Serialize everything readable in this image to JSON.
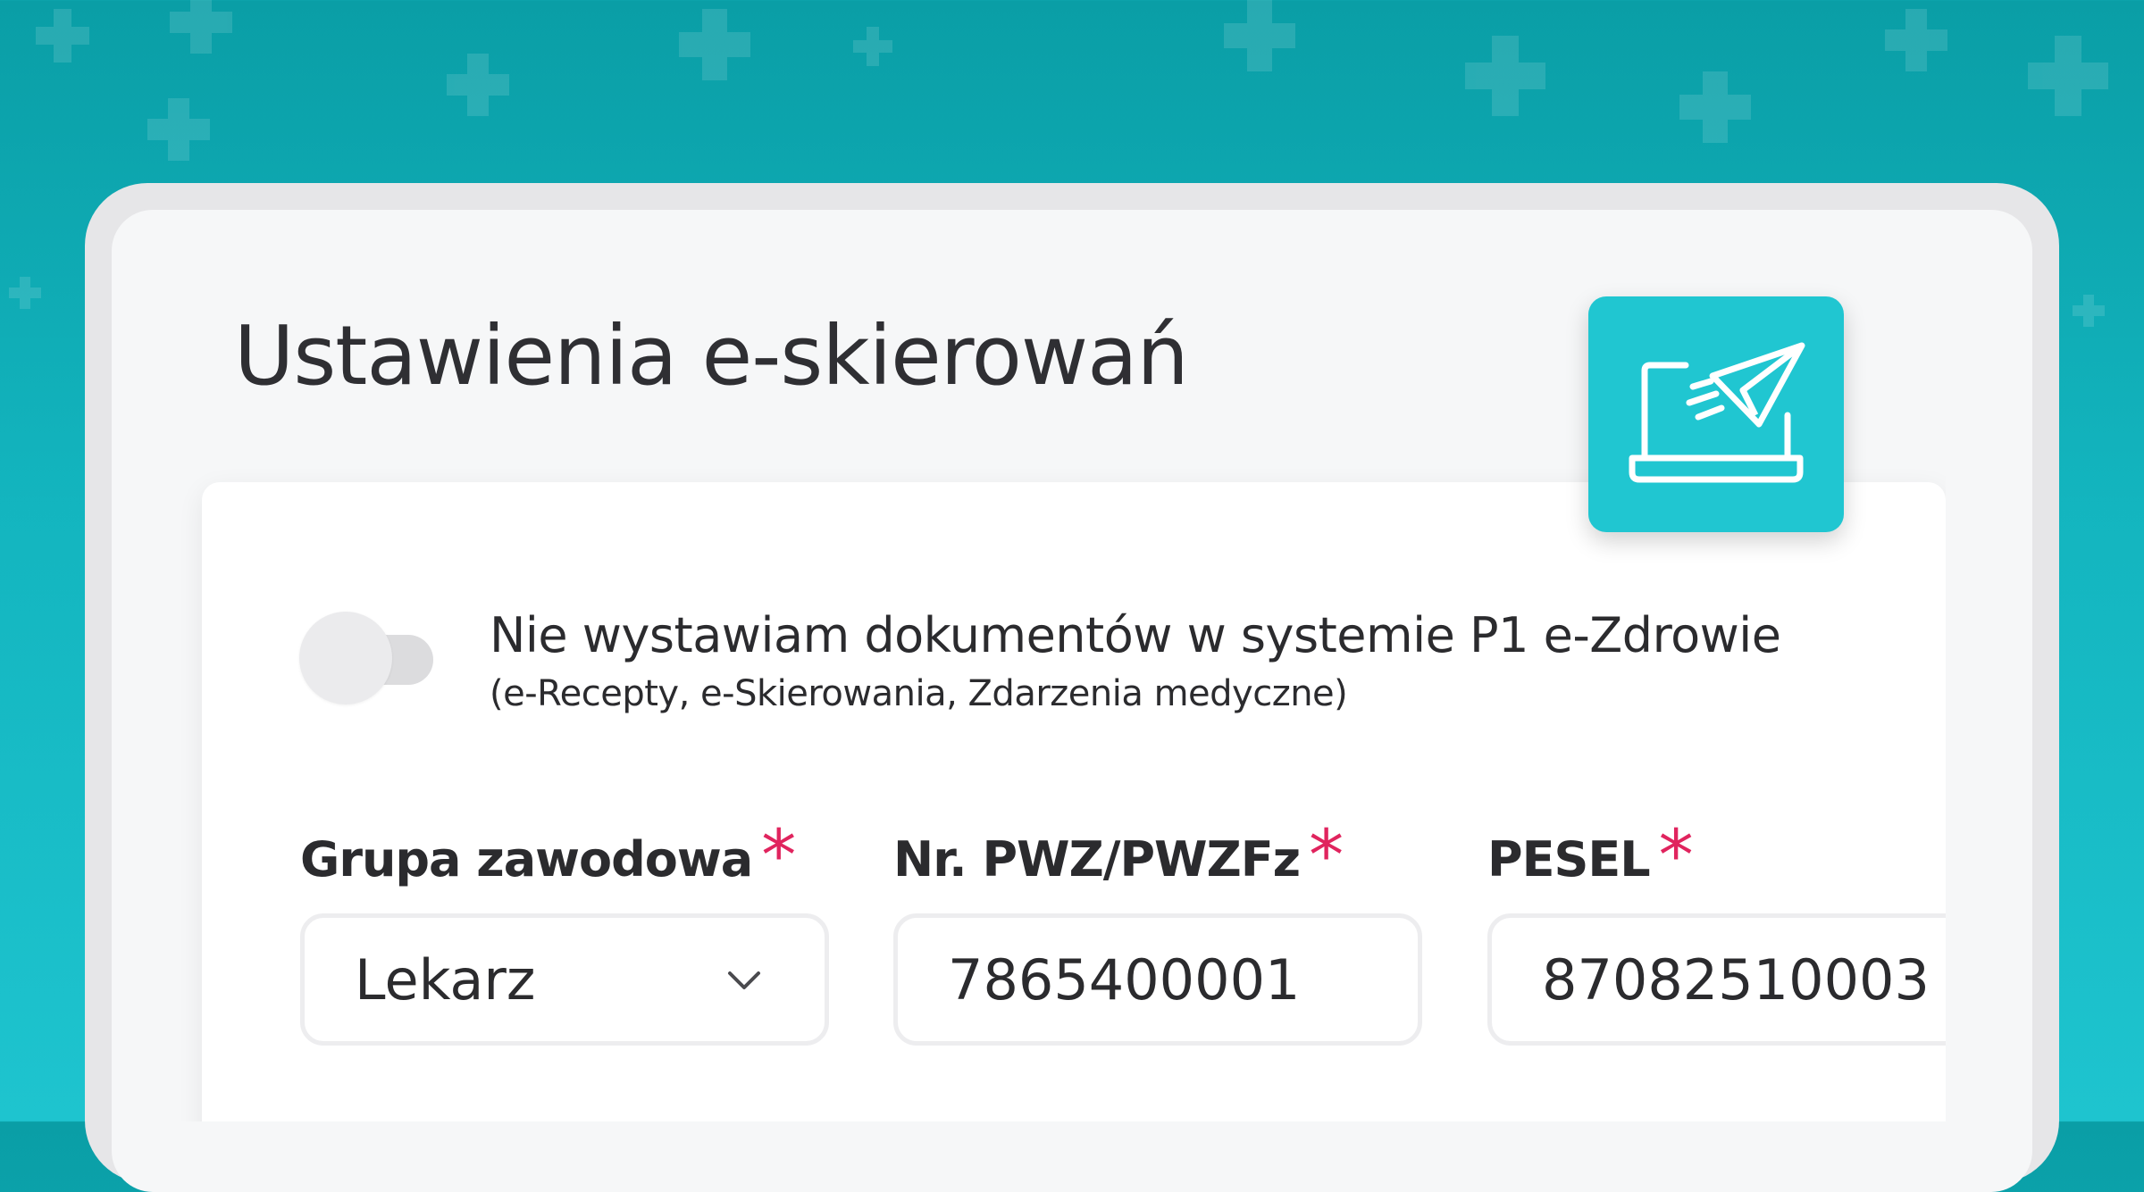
{
  "page": {
    "title": "Ustawienia e-skierowań",
    "badge_icon": "laptop-send-icon"
  },
  "colors": {
    "background": "#13b5bf",
    "accent": "#20c6d1",
    "required": "#e0245e"
  },
  "toggle": {
    "state": "off",
    "label": "Nie wystawiam dokumentów w systemie P1 e-Zdrowie",
    "sublabel": "(e-Recepty, e-Skierowania, Zdarzenia medyczne)"
  },
  "fields": [
    {
      "label": "Grupa zawodowa",
      "required_mark": "*",
      "value": "Lekarz",
      "type": "select"
    },
    {
      "label": "Nr. PWZ/PWZFz",
      "required_mark": "*",
      "value": "7865400001",
      "type": "text"
    },
    {
      "label": "PESEL",
      "required_mark": "*",
      "value": "87082510003",
      "type": "text"
    }
  ]
}
